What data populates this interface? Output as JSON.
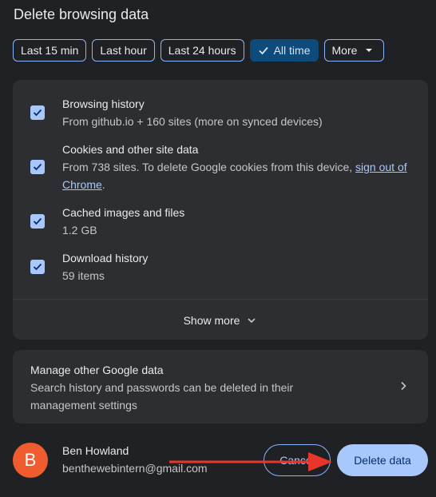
{
  "dialog": {
    "title": "Delete browsing data"
  },
  "time_ranges": [
    {
      "label": "Last 15 min",
      "selected": false
    },
    {
      "label": "Last hour",
      "selected": false
    },
    {
      "label": "Last 24 hours",
      "selected": false
    },
    {
      "label": "All time",
      "selected": true
    },
    {
      "label": "More",
      "selected": false
    }
  ],
  "items": [
    {
      "title": "Browsing history",
      "desc": "From github.io + 160 sites (more on synced devices)",
      "checked": true
    },
    {
      "title": "Cookies and other site data",
      "desc_prefix": "From 738 sites. To delete Google cookies from this device, ",
      "desc_link": "sign out of Chrome",
      "desc_suffix": ".",
      "checked": true
    },
    {
      "title": "Cached images and files",
      "desc": "1.2 GB",
      "checked": true
    },
    {
      "title": "Download history",
      "desc": "59 items",
      "checked": true
    }
  ],
  "show_more_label": "Show more",
  "manage": {
    "title": "Manage other Google data",
    "desc": "Search history and passwords can be deleted in their management settings"
  },
  "account": {
    "initial": "B",
    "name": "Ben Howland",
    "email": "benthewebintern@gmail.com"
  },
  "buttons": {
    "cancel": "Cancel",
    "delete": "Delete data"
  },
  "colors": {
    "accent": "#a8c7fa",
    "avatar": "#f15c2f",
    "annotation_arrow": "#e8362a"
  }
}
